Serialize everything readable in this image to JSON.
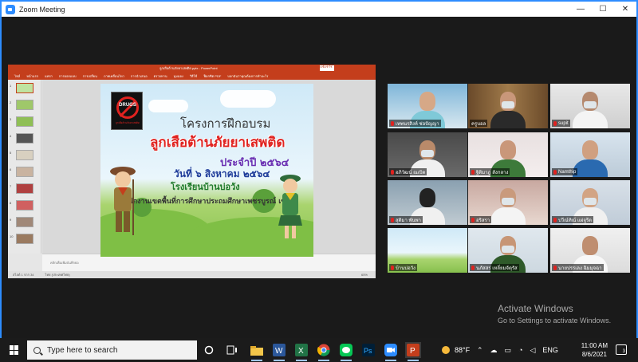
{
  "window": {
    "title": "Zoom Meeting",
    "minimize": "—",
    "maximize": "☐",
    "close": "✕"
  },
  "ppt": {
    "doc_title": "ลูกเสือต้านภัยยาเสพติด.pptx - PowerPoint",
    "signin": "ลงชื่อเข้าใช้",
    "tabs": [
      "ไฟล์",
      "หน้าแรก",
      "แทรก",
      "การออกแบบ",
      "การเปลี่ยน",
      "ภาพเคลื่อนไหว",
      "การนำเสนอ",
      "ตรวจทาน",
      "มุมมอง",
      "วิธีใช้",
      "ฟ็อกซิต PDF"
    ],
    "tell_me": "บอกฉันว่าคุณต้องการทำอะไร",
    "thumb_numbers": [
      "1",
      "2",
      "3",
      "4",
      "5",
      "6",
      "7",
      "8",
      "9",
      "10"
    ],
    "notes_placeholder": "คลิกเพื่อเพิ่มบันทึกย่อ",
    "status_slide": "สไลด์ 1 จาก 34",
    "status_lang": "ไทย (ประเทศไทย)",
    "status_zoom": "65%"
  },
  "slide": {
    "logo_text": "DRUGS",
    "logo_caption": "ลูกเสือต้านภัยยาเสพติด",
    "line1": "โครงการฝึกอบรม",
    "line2": "ลูกเสือต้านภัยยาเสพติด",
    "line3": "ประจำปี ๒๕๖๔",
    "line4": "วันที่ ๖ สิงหาคม ๒๕๖๔",
    "line5": "โรงเรียนบ้านบ่อวัง",
    "line6": "สำนักงานเขตพื้นที่การศึกษาประถมศึกษาเพชรบูรณ์ เขต ๑"
  },
  "participants": [
    {
      "name": "เทพนรสิงห์ ช่อปัญญา",
      "active": false
    },
    {
      "name": "ครูบอล",
      "active": true
    },
    {
      "name": "supit",
      "active": false
    },
    {
      "name": "อภิวัฒน์ ณเบิด",
      "active": false
    },
    {
      "name": "ฐิติมาฎ สังกลาง",
      "active": false
    },
    {
      "name": "Namthip",
      "active": false
    },
    {
      "name": "สุติมา พันพา",
      "active": false
    },
    {
      "name": "อริสรา",
      "active": false
    },
    {
      "name": "ปวีณ์ทิณ์ แผ่จูรีต",
      "active": false
    },
    {
      "name": "บ้านบ่อวัง",
      "active": false
    },
    {
      "name": "นภัสสร เหลี่ยมจัตุรัส",
      "active": false
    },
    {
      "name": "นายปรรเลง ฉิมมุจฉา",
      "active": false
    }
  ],
  "hand_icon": "raised-hand-icon",
  "watermark": {
    "title": "Activate Windows",
    "subtitle": "Go to Settings to activate Windows."
  },
  "taskbar": {
    "search_placeholder": "Type here to search",
    "weather": "88°F",
    "language": "ENG",
    "time": "11:00 AM",
    "date": "8/6/2021",
    "notifications": "3"
  },
  "colors": {
    "zoom_blue": "#2d8cff",
    "ppt_red": "#c43e1c",
    "active_speaker": "#e7e13a"
  }
}
